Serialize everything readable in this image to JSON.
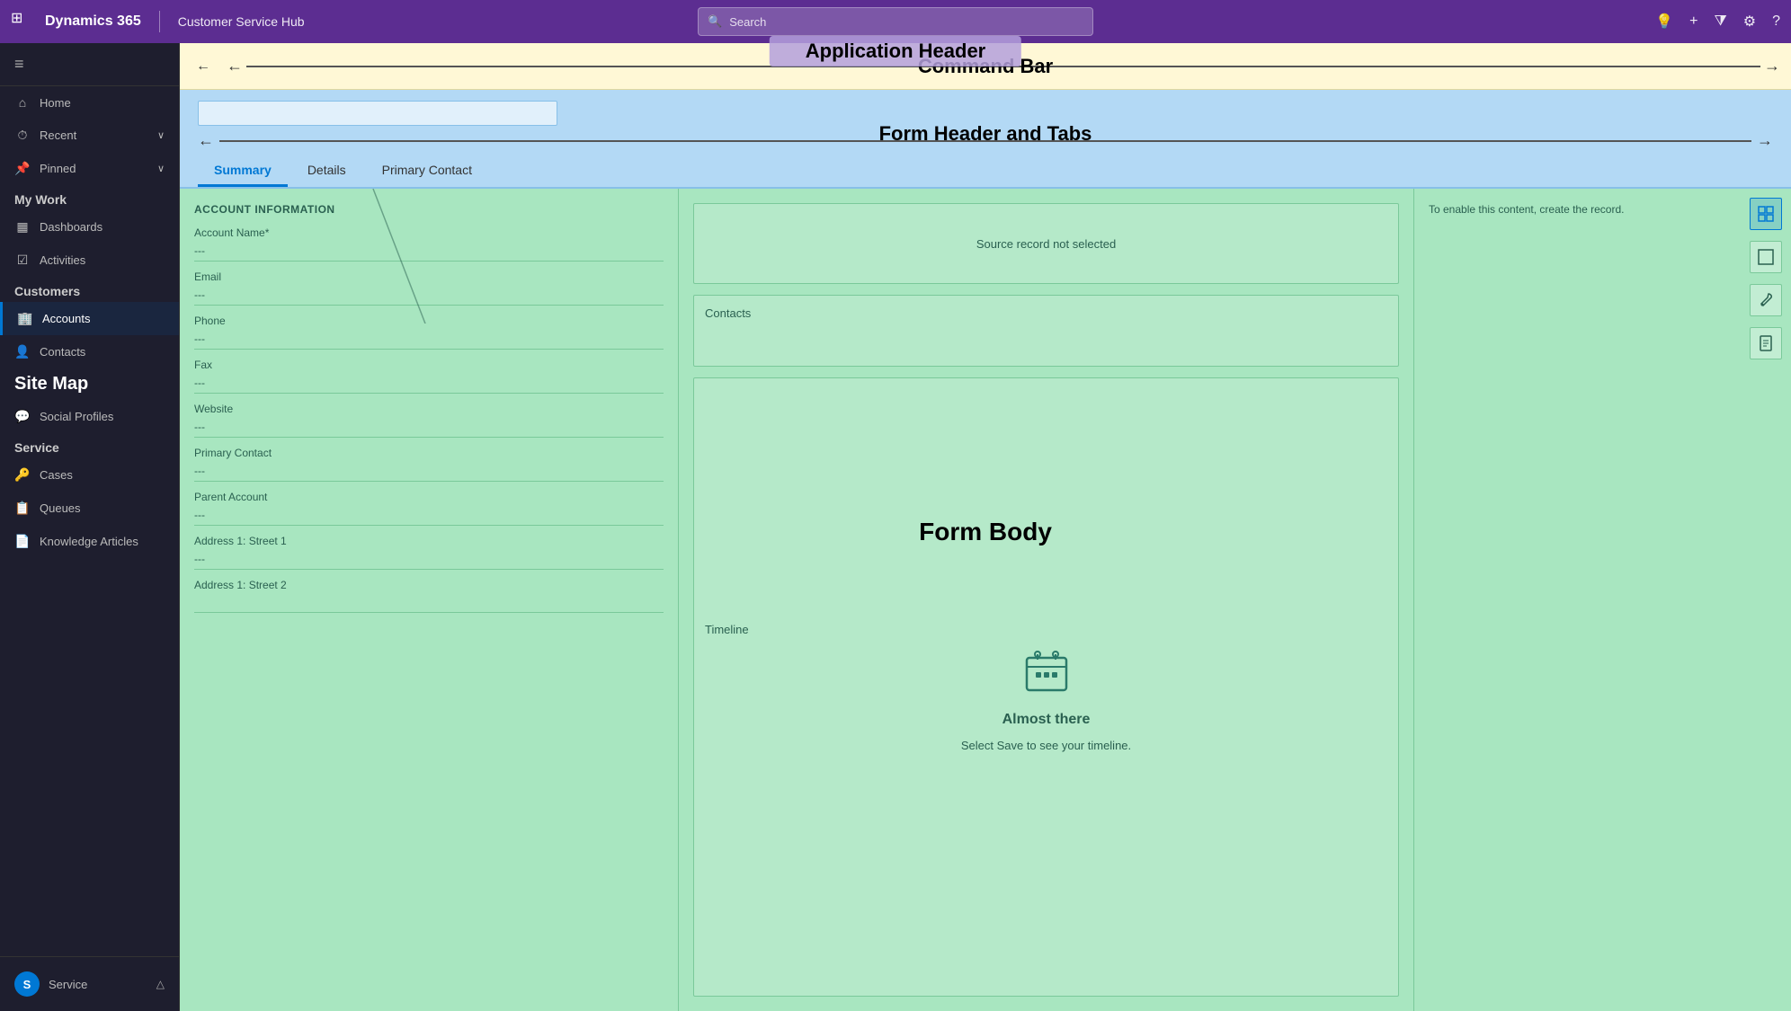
{
  "app_header": {
    "waffle_icon": "⊞",
    "app_name": "Dynamics 365",
    "module_name": "Customer Service Hub",
    "search_placeholder": "Search",
    "title": "Application Header",
    "icons": {
      "lightbulb": "💡",
      "plus": "+",
      "filter": "⧩",
      "settings": "⚙",
      "help": "?"
    }
  },
  "command_bar": {
    "label": "Command Bar",
    "back_icon": "←"
  },
  "form_header": {
    "label": "Form Header and Tabs",
    "title_placeholder": "",
    "tabs": [
      {
        "id": "summary",
        "label": "Summary",
        "active": true
      },
      {
        "id": "details",
        "label": "Details",
        "active": false
      },
      {
        "id": "primary_contact",
        "label": "Primary Contact",
        "active": false
      }
    ]
  },
  "form_body": {
    "label": "Form Body",
    "left_panel": {
      "section_title": "ACCOUNT INFORMATION",
      "fields": [
        {
          "label": "Account Name*",
          "value": "---"
        },
        {
          "label": "Email",
          "value": "---"
        },
        {
          "label": "Phone",
          "value": "---"
        },
        {
          "label": "Fax",
          "value": "---"
        },
        {
          "label": "Website",
          "value": "---"
        },
        {
          "label": "Primary Contact",
          "value": "---"
        },
        {
          "label": "Parent Account",
          "value": "---"
        },
        {
          "label": "Address 1: Street 1",
          "value": "---"
        },
        {
          "label": "Address 1: Street 2",
          "value": ""
        }
      ]
    },
    "middle_panel": {
      "source_record_text": "Source record not selected",
      "contacts_label": "Contacts",
      "timeline_label": "Timeline",
      "almost_there_title": "Almost there",
      "almost_there_desc": "Select Save to see your timeline."
    },
    "right_panel": {
      "enable_text": "To enable this content, create the record.",
      "icons": [
        "grid",
        "square",
        "wrench",
        "document"
      ]
    }
  },
  "sidebar": {
    "hamburger": "≡",
    "nav_items": [
      {
        "id": "home",
        "icon": "⌂",
        "label": "Home",
        "has_chevron": false
      },
      {
        "id": "recent",
        "icon": "⏱",
        "label": "Recent",
        "has_chevron": true
      },
      {
        "id": "pinned",
        "icon": "📌",
        "label": "Pinned",
        "has_chevron": true
      }
    ],
    "my_work_label": "My Work",
    "my_work_items": [
      {
        "id": "dashboards",
        "icon": "▦",
        "label": "Dashboards"
      },
      {
        "id": "activities",
        "icon": "☑",
        "label": "Activities"
      }
    ],
    "customers_label": "Customers",
    "customers_items": [
      {
        "id": "accounts",
        "icon": "🏢",
        "label": "Accounts",
        "active": true
      },
      {
        "id": "contacts",
        "icon": "👤",
        "label": "Contacts"
      },
      {
        "id": "social_profiles",
        "icon": "💬",
        "label": "Social Profiles"
      }
    ],
    "site_map_label": "Site Map",
    "service_label": "Service",
    "service_items": [
      {
        "id": "cases",
        "icon": "🔑",
        "label": "Cases"
      },
      {
        "id": "queues",
        "icon": "📋",
        "label": "Queues"
      },
      {
        "id": "knowledge_articles",
        "icon": "📄",
        "label": "Knowledge Articles"
      }
    ],
    "footer": {
      "avatar_text": "S",
      "service_text": "Service",
      "chevron_icon": "△"
    }
  }
}
